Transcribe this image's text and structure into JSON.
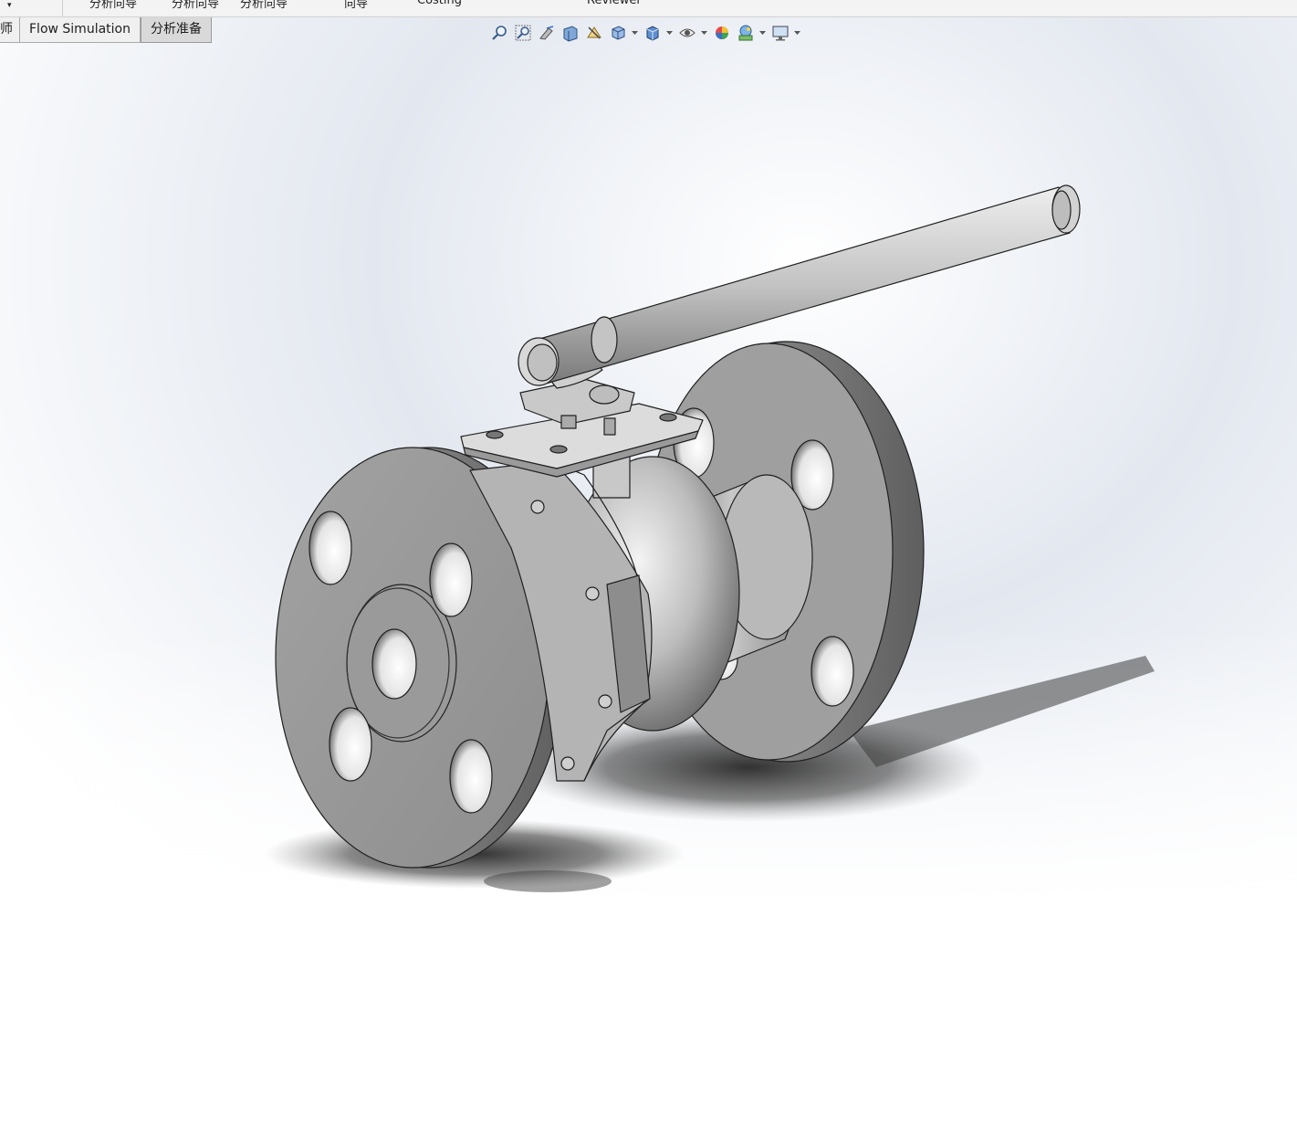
{
  "ribbon": {
    "items": [
      {
        "label": "分析向导"
      },
      {
        "label": "分析向导"
      },
      {
        "label": "分析向导"
      },
      {
        "label": "向导"
      },
      {
        "label": "Costing"
      },
      {
        "label": "Reviewer"
      }
    ]
  },
  "tabs": [
    {
      "label": "师",
      "active": false
    },
    {
      "label": "Flow Simulation",
      "active": false
    },
    {
      "label": "分析准备",
      "active": true
    }
  ],
  "headsup_toolbar": [
    {
      "icon": "zoom-to-fit-icon"
    },
    {
      "icon": "zoom-to-area-icon"
    },
    {
      "icon": "previous-view-icon"
    },
    {
      "icon": "section-view-icon"
    },
    {
      "icon": "dynamic-annotation-icon"
    },
    {
      "icon": "view-orientation-icon",
      "dropdown": true
    },
    {
      "icon": "display-style-icon",
      "dropdown": true
    },
    {
      "icon": "hide-show-items-icon",
      "dropdown": true
    },
    {
      "icon": "edit-appearance-icon"
    },
    {
      "icon": "apply-scene-icon",
      "dropdown": true
    },
    {
      "icon": "view-settings-icon",
      "dropdown": true
    }
  ],
  "colors": {
    "background_top": "#dfe4ec",
    "background_bottom": "#ffffff",
    "part_metal": "#a9a9a9",
    "edge": "#202020"
  }
}
